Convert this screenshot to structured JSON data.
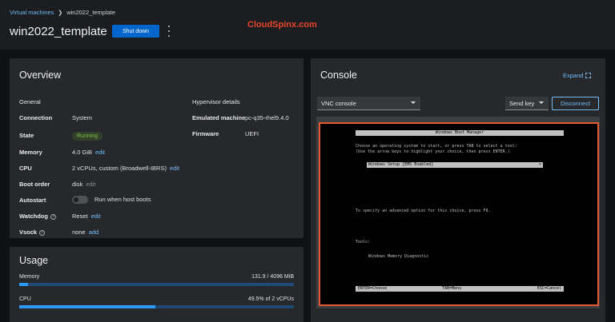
{
  "breadcrumb": {
    "parent": "Virtual machines",
    "current": "win2022_template"
  },
  "header": {
    "title": "win2022_template",
    "shutdown_label": "Shut down",
    "watermark": "CloudSpinx.com"
  },
  "overview": {
    "title": "Overview",
    "general_heading": "General",
    "hypervisor_heading": "Hypervisor details",
    "connection_label": "Connection",
    "connection_value": "System",
    "state_label": "State",
    "state_value": "Running",
    "memory_label": "Memory",
    "memory_value": "4.0 GiB",
    "cpu_label": "CPU",
    "cpu_value": "2 vCPUs, custom (Broadwell-IBRS)",
    "boot_label": "Boot order",
    "boot_value": "disk",
    "autostart_label": "Autostart",
    "autostart_value": "Run when host boots",
    "watchdog_label": "Watchdog",
    "watchdog_value": "Reset",
    "vsock_label": "Vsock",
    "vsock_value": "none",
    "edit_label": "edit",
    "add_label": "add",
    "emulated_label": "Emulated machine",
    "emulated_value": "pc-q35-rhel9.4.0",
    "firmware_label": "Firmware",
    "firmware_value": "UEFI"
  },
  "usage": {
    "title": "Usage",
    "memory_label": "Memory",
    "memory_value": "131.9 / 4096 MiB",
    "memory_fraction": 0.032,
    "cpu_label": "CPU",
    "cpu_value": "49.5% of 2 vCPUs",
    "cpu_fraction": 0.495
  },
  "console": {
    "title": "Console",
    "expand_label": "Expand",
    "console_type": "VNC console",
    "send_key_label": "Send key",
    "disconnect_label": "Disconnect",
    "screen": {
      "title": "Windows Boot Manager",
      "line1": "Choose an operating system to start, or press TAB to select a tool:",
      "line2": "(Use the arrow keys to highlight your choice, then press ENTER.)",
      "selected_entry": "Windows Setup [EMS Enabled]",
      "selected_arrow": ">",
      "advanced": "To specify an advanced option for this choice, press F8.",
      "tools_heading": "Tools:",
      "tool1": "Windows Memory Diagnostic",
      "foot_enter": "ENTER=Choose",
      "foot_tab": "TAB=Menu",
      "foot_esc": "ESC=Cancel"
    }
  },
  "colors": {
    "accent": "#0066cc",
    "link": "#73bcf7",
    "running": "#7fbf4a",
    "highlight": "#e55a30"
  }
}
